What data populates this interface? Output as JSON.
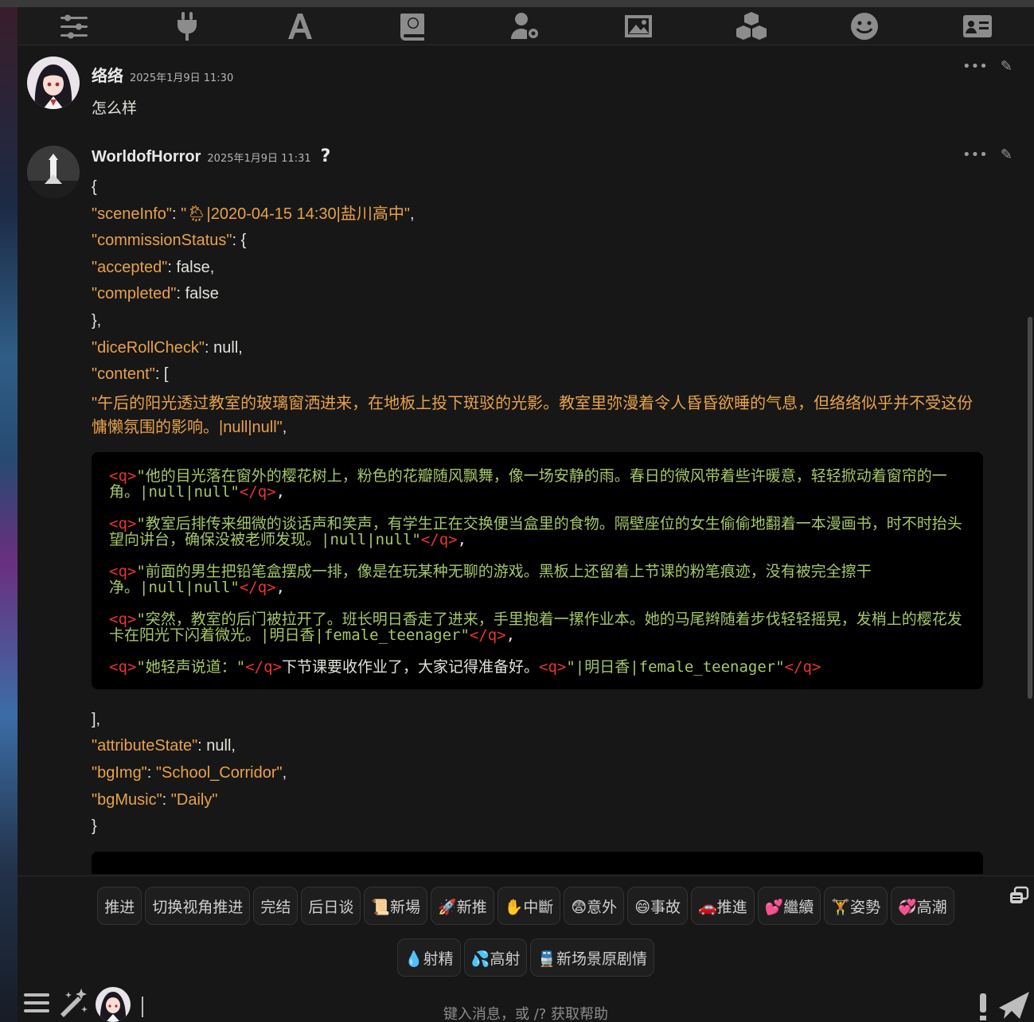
{
  "topbar": {
    "icons": [
      "sliders-icon",
      "plug-icon",
      "font-icon",
      "book-atlas-icon",
      "user-gear-icon",
      "image-icon",
      "cubes-icon",
      "smile-icon",
      "id-card-icon"
    ]
  },
  "messages": [
    {
      "name": "络络",
      "time": "2025年1月9日 11:30",
      "text": "怎么样"
    },
    {
      "name": "WorldofHorror",
      "time": "2025年1月9日 11:31",
      "qmark": "?",
      "json": {
        "open": "{",
        "sceneInfo_key": "\"sceneInfo\"",
        "sceneInfo_val": "\"🌦|2020-04-15 14:30|盐川高中\"",
        "commissionStatus_key": "\"commissionStatus\"",
        "commissionStatus_open": ": {",
        "accepted_key": "\"accepted\"",
        "accepted_val": ": false,",
        "completed_key": "\"completed\"",
        "completed_val": ": false",
        "close_obj": "},",
        "diceRollCheck_key": "\"diceRollCheck\"",
        "diceRollCheck_val": ": null,",
        "content_key": "\"content\"",
        "content_open": ": [",
        "content_first": "\"午后的阳光透过教室的玻璃窗洒进来，在地板上投下斑驳的光影。教室里弥漫着令人昏昏欲睡的气息，但络络似乎并不受这份慵懒氛围的影响。|null|null\"",
        "content_first_tail": ",",
        "code_lines": [
          {
            "text": "\"他的目光落在窗外的樱花树上，粉色的花瓣随风飘舞，像一场安静的雨。春日的微风带着些许暖意，轻轻掀动着窗帘的一角。|null|null\""
          },
          {
            "text": "\"教室后排传来细微的谈话声和笑声，有学生正在交换便当盒里的食物。隔壁座位的女生偷偷地翻着一本漫画书，时不时抬头望向讲台，确保没被老师发现。|null|null\""
          },
          {
            "text": "\"前面的男生把铅笔盒摆成一排，像是在玩某种无聊的游戏。黑板上还留着上节课的粉笔痕迹，没有被完全擦干净。|null|null\""
          },
          {
            "text": "\"突然，教室的后门被拉开了。班长明日香走了进来，手里抱着一摞作业本。她的马尾辫随着步伐轻轻摇晃，发梢上的樱花发卡在阳光下闪着微光。|明日香|female_teenager\""
          }
        ],
        "code_last_a": "\"她轻声说道：\"",
        "code_last_b": "下节课要收作业了，大家记得准备好。",
        "code_last_c": "\"|明日香|female_teenager\"",
        "tag_open": "<q>",
        "tag_close": "</q>",
        "comma": ",",
        "close_arr": "],",
        "attributeState_key": "\"attributeState\"",
        "attributeState_val": ": null,",
        "bgImg_key": "\"bgImg\"",
        "bgImg_val": "\"School_Corridor\"",
        "bgMusic_key": "\"bgMusic\"",
        "bgMusic_val": "\"Daily\"",
        "close": "}"
      }
    }
  ],
  "quick_replies_row1": [
    "推进",
    "切换视角推进",
    "完结",
    "后日谈",
    "📜新場",
    "🚀新推",
    "✋中斷",
    "😨意外",
    "😄事故",
    "🚗推進",
    "💕繼續",
    "🏋姿勢",
    "💞高潮"
  ],
  "quick_replies_row2": [
    "💧射精",
    "💦高射",
    "🚆新场景原剧情"
  ],
  "input": {
    "placeholder": "键入消息，或 /? 获取帮助"
  },
  "colors": {
    "background": "#171717",
    "json_key": "#e8a24a",
    "tag_red": "#e5362f",
    "code_green": "#a6c66a"
  }
}
